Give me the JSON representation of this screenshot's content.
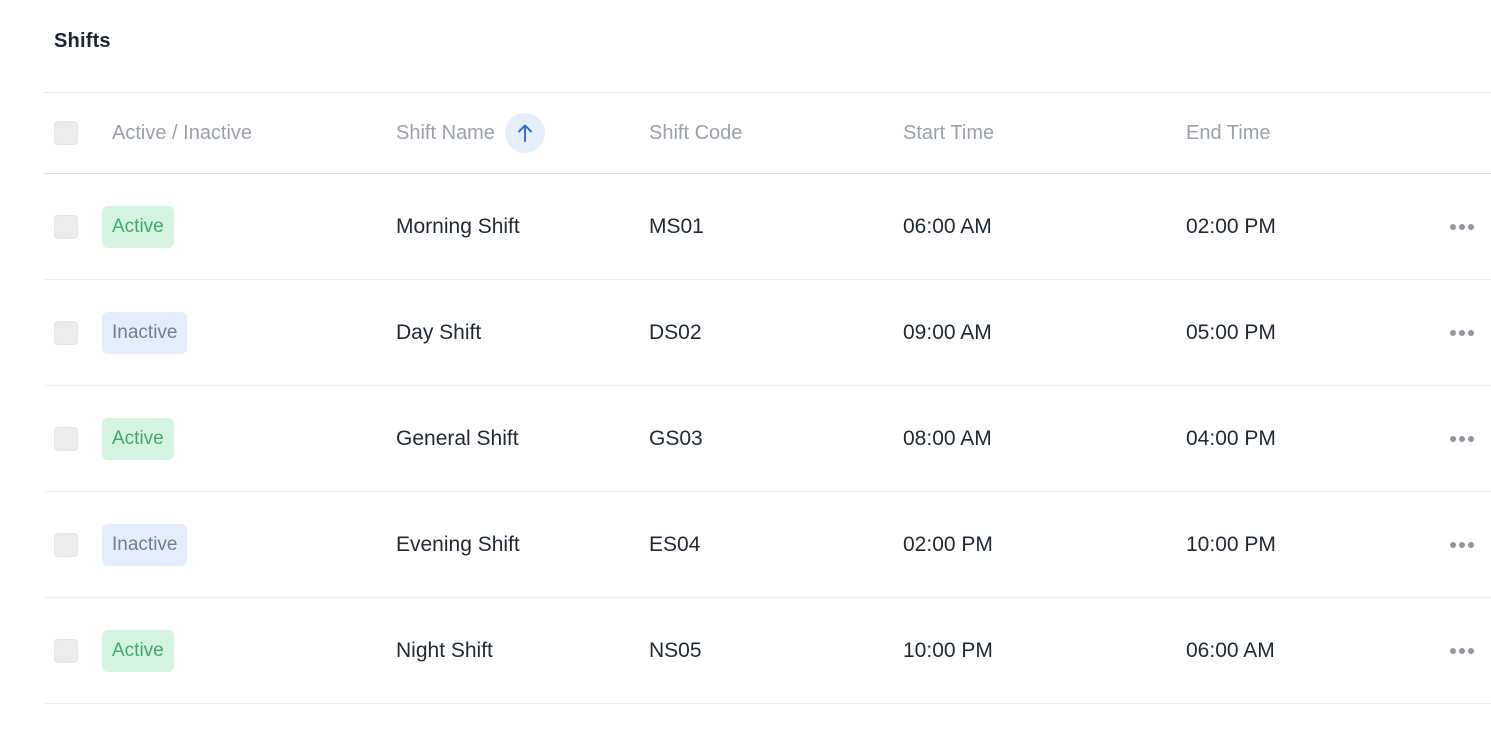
{
  "page": {
    "title": "Shifts"
  },
  "table": {
    "columns": {
      "status": "Active / Inactive",
      "name": "Shift Name",
      "code": "Shift Code",
      "start": "Start Time",
      "end": "End Time"
    },
    "sort": {
      "column": "name",
      "direction": "ascending",
      "icon": "arrow-up-icon"
    },
    "rows": [
      {
        "status": "Active",
        "name": "Morning Shift",
        "code": "MS01",
        "start": "06:00 AM",
        "end": "02:00 PM"
      },
      {
        "status": "Inactive",
        "name": "Day Shift",
        "code": "DS02",
        "start": "09:00 AM",
        "end": "05:00 PM"
      },
      {
        "status": "Active",
        "name": "General Shift",
        "code": "GS03",
        "start": "08:00 AM",
        "end": "04:00 PM"
      },
      {
        "status": "Inactive",
        "name": "Evening Shift",
        "code": "ES04",
        "start": "02:00 PM",
        "end": "10:00 PM"
      },
      {
        "status": "Active",
        "name": "Night Shift",
        "code": "NS05",
        "start": "10:00 PM",
        "end": "06:00 AM"
      }
    ]
  },
  "colors": {
    "active_bg": "#d4f3e0",
    "active_text": "#3fa86a",
    "inactive_bg": "#e3edfb",
    "inactive_text": "#6f7e93",
    "sort_accent": "#2f6fc6"
  },
  "icons": {
    "row_actions": "more-horizontal-icon"
  }
}
